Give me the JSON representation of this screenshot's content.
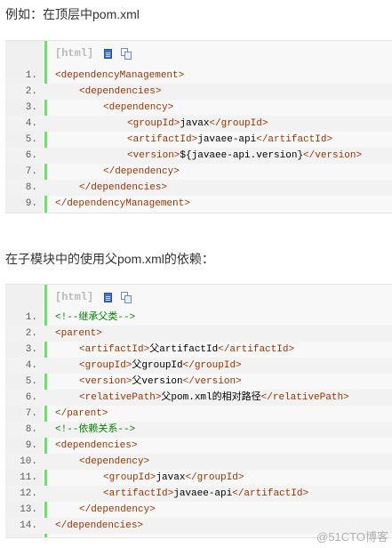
{
  "intro_text": "例如：在顶层中pom.xml",
  "second_text": "在子模块中的使用父pom.xml的依赖：",
  "toolbar": {
    "label": "[html]",
    "view_source_icon": "view-source-icon",
    "copy_icon": "copy-icon"
  },
  "colors": {
    "tag": "#993300",
    "text": "#000000",
    "comment": "#008200",
    "gutter_bar": "#6ce26c"
  },
  "code_block_1": {
    "lines": [
      {
        "num": "1.",
        "segments": [
          {
            "t": "tag",
            "v": "<dependencyManagement>"
          }
        ]
      },
      {
        "num": "2.",
        "segments": [
          {
            "t": "tag",
            "v": "<dependencies>"
          }
        ]
      },
      {
        "num": "3.",
        "segments": [
          {
            "t": "tag",
            "v": "<dependency>"
          }
        ]
      },
      {
        "num": "4.",
        "segments": [
          {
            "t": "tag",
            "v": "<groupId>"
          },
          {
            "t": "txt",
            "v": "javax"
          },
          {
            "t": "tag",
            "v": "</groupId>"
          }
        ]
      },
      {
        "num": "5.",
        "segments": [
          {
            "t": "tag",
            "v": "<artifactId>"
          },
          {
            "t": "txt",
            "v": "javaee-api"
          },
          {
            "t": "tag",
            "v": "</artifactId>"
          }
        ]
      },
      {
        "num": "6.",
        "segments": [
          {
            "t": "tag",
            "v": "<version>"
          },
          {
            "t": "txt",
            "v": "${javaee-api.version}"
          },
          {
            "t": "tag",
            "v": "</version>"
          }
        ]
      },
      {
        "num": "7.",
        "segments": [
          {
            "t": "tag",
            "v": "</dependency>"
          }
        ]
      },
      {
        "num": "8.",
        "segments": [
          {
            "t": "tag",
            "v": "</dependencies>"
          }
        ]
      },
      {
        "num": "9.",
        "segments": [
          {
            "t": "tag",
            "v": "</dependencyManagement>"
          }
        ]
      }
    ]
  },
  "code_block_2": {
    "lines": [
      {
        "num": "1.",
        "segments": [
          {
            "t": "cmt",
            "v": "<!--继承父类-->"
          }
        ]
      },
      {
        "num": "2.",
        "segments": [
          {
            "t": "tag",
            "v": "<parent>"
          }
        ]
      },
      {
        "num": "3.",
        "segments": [
          {
            "t": "tag",
            "v": "<artifactId>"
          },
          {
            "t": "txt",
            "v": "父artifactId"
          },
          {
            "t": "tag",
            "v": "</artifactId>"
          }
        ]
      },
      {
        "num": "4.",
        "segments": [
          {
            "t": "tag",
            "v": "<groupId>"
          },
          {
            "t": "txt",
            "v": "父groupId"
          },
          {
            "t": "tag",
            "v": "</groupId>"
          }
        ]
      },
      {
        "num": "5.",
        "segments": [
          {
            "t": "tag",
            "v": "<version>"
          },
          {
            "t": "txt",
            "v": "父version"
          },
          {
            "t": "tag",
            "v": "</version>"
          }
        ]
      },
      {
        "num": "6.",
        "segments": [
          {
            "t": "tag",
            "v": "<relativePath>"
          },
          {
            "t": "txt",
            "v": "父pom.xml的相对路径"
          },
          {
            "t": "tag",
            "v": "</relativePath>"
          }
        ]
      },
      {
        "num": "7.",
        "segments": [
          {
            "t": "tag",
            "v": "</parent>"
          }
        ]
      },
      {
        "num": "8.",
        "segments": [
          {
            "t": "cmt",
            "v": "<!--依赖关系-->"
          }
        ]
      },
      {
        "num": "9.",
        "segments": [
          {
            "t": "tag",
            "v": "<dependencies>"
          }
        ]
      },
      {
        "num": "10.",
        "segments": [
          {
            "t": "tag",
            "v": "<dependency>"
          }
        ]
      },
      {
        "num": "11.",
        "segments": [
          {
            "t": "tag",
            "v": "<groupId>"
          },
          {
            "t": "txt",
            "v": "javax"
          },
          {
            "t": "tag",
            "v": "</groupId>"
          }
        ]
      },
      {
        "num": "12.",
        "segments": [
          {
            "t": "tag",
            "v": "<artifactId>"
          },
          {
            "t": "txt",
            "v": "javaee-api"
          },
          {
            "t": "tag",
            "v": "</artifactId>"
          }
        ]
      },
      {
        "num": "13.",
        "segments": [
          {
            "t": "tag",
            "v": "</dependency>"
          }
        ]
      },
      {
        "num": "14.",
        "segments": [
          {
            "t": "tag",
            "v": "</dependencies>"
          }
        ]
      }
    ]
  },
  "watermark": "@51CTO博客"
}
